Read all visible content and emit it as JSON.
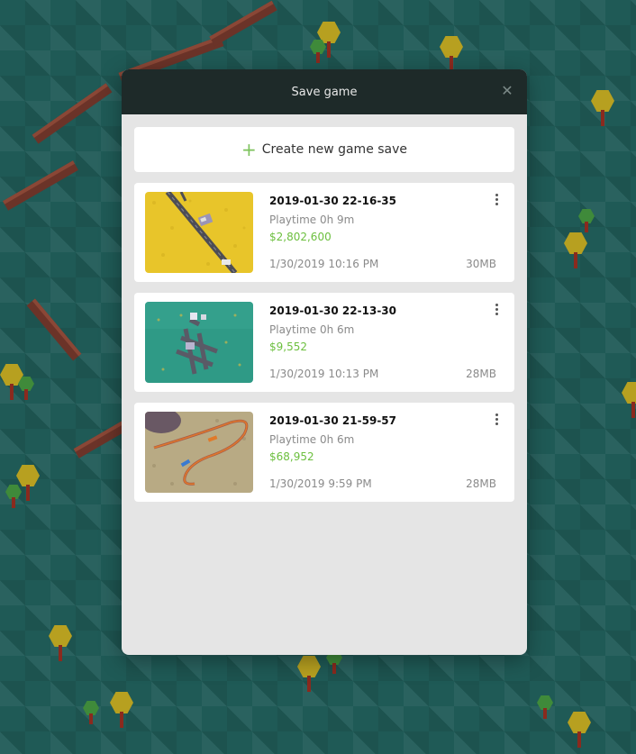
{
  "modal": {
    "title": "Save game",
    "close_icon": "close-icon",
    "create_label": "Create new game save",
    "create_icon": "plus-icon"
  },
  "saves": [
    {
      "name": "2019-01-30 22-16-35",
      "playtime": "Playtime 0h 9m",
      "money": "$2,802,600",
      "date": "1/30/2019 10:16 PM",
      "size": "30MB",
      "thumbnail": "yellow-field-road"
    },
    {
      "name": "2019-01-30 22-13-30",
      "playtime": "Playtime 0h 6m",
      "money": "$9,552",
      "date": "1/30/2019 10:13 PM",
      "size": "28MB",
      "thumbnail": "teal-grid-buildings"
    },
    {
      "name": "2019-01-30 21-59-57",
      "playtime": "Playtime 0h 6m",
      "money": "$68,952",
      "date": "1/30/2019 9:59 PM",
      "size": "28MB",
      "thumbnail": "sandy-rail-loop"
    }
  ],
  "colors": {
    "money": "#6cbf3e",
    "header": "#1e2a29",
    "background": "#1f5a56"
  }
}
